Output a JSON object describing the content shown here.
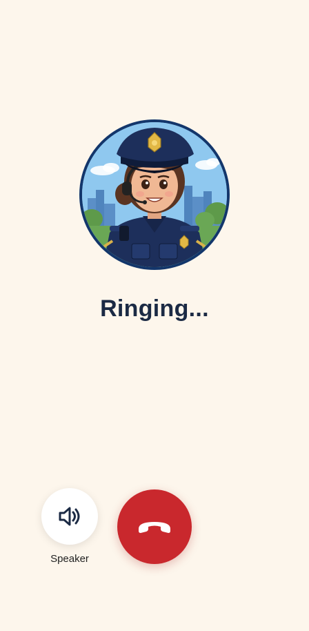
{
  "call": {
    "status": "Ringing..."
  },
  "controls": {
    "speaker_label": "Speaker"
  },
  "colors": {
    "background": "#fdf6ec",
    "hangup": "#c9282d",
    "avatar_border": "#13366b",
    "status_text": "#1b2a44"
  },
  "icons": {
    "speaker": "speaker-icon",
    "hangup": "phone-hangup-icon"
  }
}
